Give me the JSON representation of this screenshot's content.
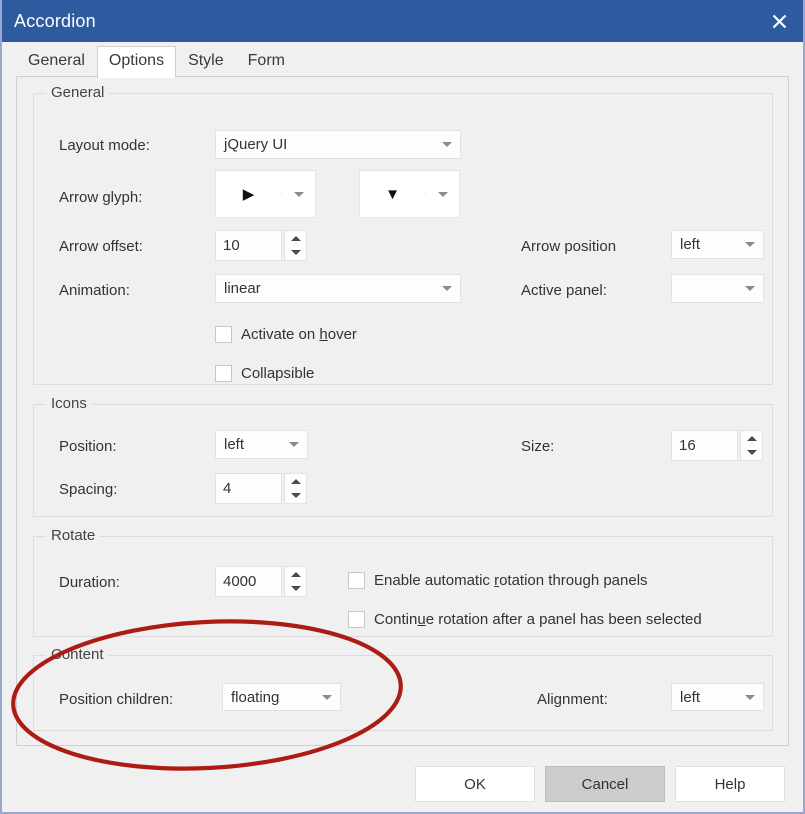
{
  "window": {
    "title": "Accordion",
    "close_icon": "close-icon",
    "titlebar_color": "#2e5b9f"
  },
  "tabs": [
    {
      "label": "General",
      "selected": false
    },
    {
      "label": "Options",
      "selected": true
    },
    {
      "label": "Style",
      "selected": false
    },
    {
      "label": "Form",
      "selected": false
    }
  ],
  "groups": {
    "general": {
      "title": "General",
      "layout_mode": {
        "label": "Layout mode:",
        "value": "jQuery UI"
      },
      "arrow_glyph": {
        "label": "Arrow glyph:",
        "value_collapsed": "▶",
        "value_expanded": "▼"
      },
      "arrow_offset": {
        "label": "Arrow offset:",
        "value": "10"
      },
      "animation": {
        "label": "Animation:",
        "value": "linear"
      },
      "arrow_position": {
        "label": "Arrow position",
        "value": "left"
      },
      "active_panel": {
        "label": "Active panel:",
        "value": ""
      },
      "activate_on_hover": {
        "label_pre": "Activate on ",
        "label_accel": "h",
        "label_post": "over",
        "checked": false
      },
      "collapsible": {
        "label_pre": "Collapsible",
        "label_accel": "",
        "label_post": "",
        "checked": false
      }
    },
    "icons": {
      "title": "Icons",
      "position": {
        "label": "Position:",
        "value": "left"
      },
      "spacing": {
        "label": "Spacing:",
        "value": "4"
      },
      "size": {
        "label": "Size:",
        "value": "16"
      }
    },
    "rotate": {
      "title": "Rotate",
      "duration": {
        "label": "Duration:",
        "value": "4000"
      },
      "enable_auto": {
        "label_pre": "Enable automatic ",
        "label_accel": "r",
        "label_post": "otation through panels",
        "checked": false
      },
      "continue_rotation": {
        "label_pre": "Contin",
        "label_accel": "u",
        "label_post": "e rotation after a panel has been selected",
        "checked": false
      }
    },
    "content": {
      "title": "Content",
      "position_children": {
        "label": "Position children:",
        "value": "floating"
      },
      "alignment": {
        "label": "Alignment:",
        "value": "left"
      }
    }
  },
  "buttons": {
    "ok": "OK",
    "cancel": "Cancel",
    "help": "Help"
  },
  "annotation": {
    "shape": "ellipse-highlight",
    "color": "#ad1c14"
  }
}
